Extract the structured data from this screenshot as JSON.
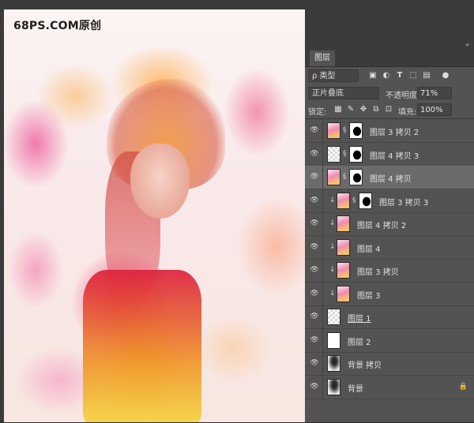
{
  "watermark": "68PS.COM原创",
  "panel": {
    "tab": "图层",
    "filter": {
      "kind": "ρ 类型",
      "icons": [
        "image-filter-icon",
        "adjustment-filter-icon",
        "type-filter-icon",
        "shape-filter-icon",
        "smart-object-filter-icon",
        "filter-toggle-icon"
      ]
    },
    "blend_mode": "正片叠底",
    "opacity_label": "不透明度:",
    "opacity_value": "71%",
    "lock_label": "锁定:",
    "lock_icons": [
      "lock-transparent-icon",
      "lock-pixels-icon",
      "lock-position-icon",
      "lock-artboard-icon",
      "lock-all-icon"
    ],
    "fill_label": "填充:",
    "fill_value": "100%"
  },
  "layers": [
    {
      "name": "图层 3 拷贝 2",
      "thumb": "color",
      "mask": true,
      "clipped": false,
      "selected": false
    },
    {
      "name": "图层 4 拷贝 3",
      "thumb": "checker",
      "mask": true,
      "clipped": false,
      "selected": false
    },
    {
      "name": "图层 4 拷贝",
      "thumb": "color",
      "mask": true,
      "clipped": false,
      "selected": true
    },
    {
      "name": "图层 3 拷贝 3",
      "thumb": "color",
      "mask": true,
      "clipped": true,
      "selected": false
    },
    {
      "name": "图层 4 拷贝 2",
      "thumb": "color",
      "mask": false,
      "clipped": true,
      "selected": false
    },
    {
      "name": "图层 4",
      "thumb": "color",
      "mask": false,
      "clipped": true,
      "selected": false
    },
    {
      "name": "图层 3 拷贝",
      "thumb": "color",
      "mask": false,
      "clipped": true,
      "selected": false
    },
    {
      "name": "图层 3",
      "thumb": "color",
      "mask": false,
      "clipped": true,
      "selected": false
    },
    {
      "name": "图层 1",
      "thumb": "checker",
      "mask": false,
      "clipped": false,
      "selected": false,
      "underlined": true
    },
    {
      "name": "图层 2",
      "thumb": "white",
      "mask": false,
      "clipped": false,
      "selected": false
    },
    {
      "name": "背景 拷贝",
      "thumb": "photo",
      "mask": false,
      "clipped": false,
      "selected": false
    },
    {
      "name": "背景",
      "thumb": "photo",
      "mask": false,
      "clipped": false,
      "selected": false,
      "locked": true
    }
  ]
}
